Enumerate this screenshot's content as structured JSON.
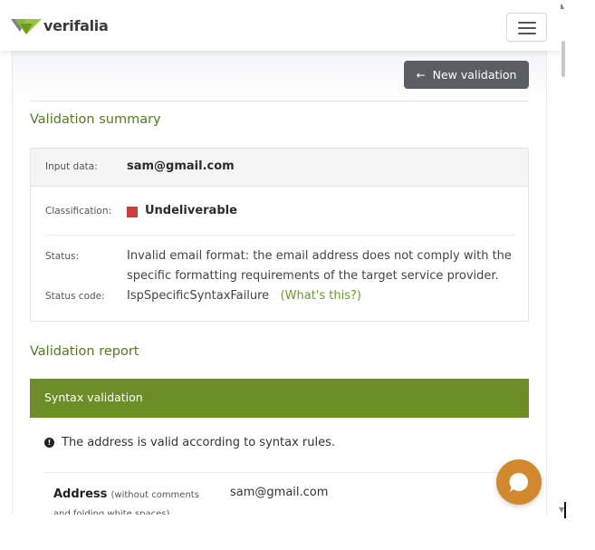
{
  "navbar": {
    "brand": "verifalia",
    "menu_icon": "hamburger-icon"
  },
  "toolbar": {
    "new_validation_label": "New validation",
    "arrow_icon": "arrow-left-icon"
  },
  "summary": {
    "title": "Validation summary",
    "input_label": "Input data:",
    "input_value": "sam@gmail.com",
    "classification_label": "Classification:",
    "classification_value": "Undeliverable",
    "classification_color": "#d03b3b",
    "status_label": "Status:",
    "status_line1": "Invalid email format: the email address does not comply with the",
    "status_line2": "specific formatting requirements of the target service provider.",
    "status_code_label": "Status code:",
    "status_code_value": "IspSpecificSyntaxFailure",
    "whats_this": "(What's this?)"
  },
  "report": {
    "title": "Validation report",
    "syntax_header": "Syntax validation",
    "syntax_message": "The address is valid according to syntax rules.",
    "address_label": "Address",
    "address_note": "(without comments and folding white spaces)",
    "address_value": "sam@gmail.com"
  },
  "colors": {
    "accent_green": "#6b8f26",
    "title_green": "#567a1f",
    "link_green": "#6b9a2a",
    "chat_orange": "#d2892e",
    "button_gray": "#5a5d61"
  }
}
